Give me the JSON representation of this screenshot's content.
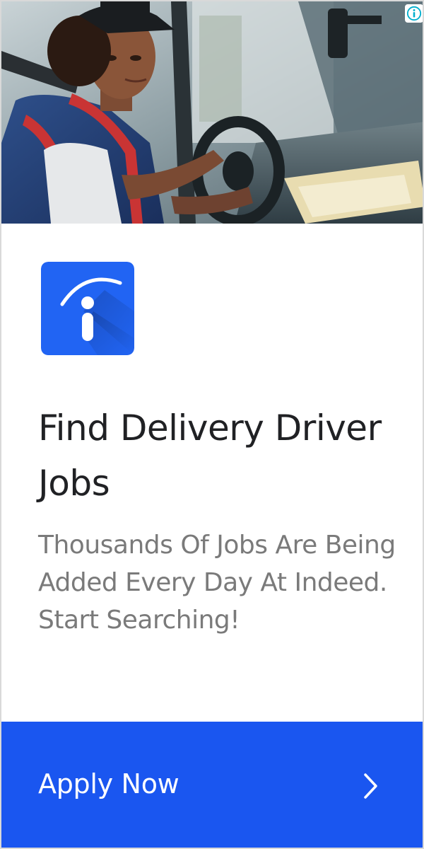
{
  "ad": {
    "hero_image": "delivery-driver-photo",
    "info_icon": "info-icon",
    "logo_icon": "indeed-logo-icon",
    "headline": "Find Delivery Driver Jobs",
    "description": "Thousands Of Jobs Are Being Added Every Day At Indeed. Start Searching!",
    "cta_label": "Apply Now",
    "cta_icon": "chevron-right-icon"
  },
  "colors": {
    "brand_blue": "#1a56f0",
    "logo_blue": "#2164f3",
    "headline": "#202124",
    "description": "#7a7a7a",
    "info_icon": "#00aecd"
  }
}
